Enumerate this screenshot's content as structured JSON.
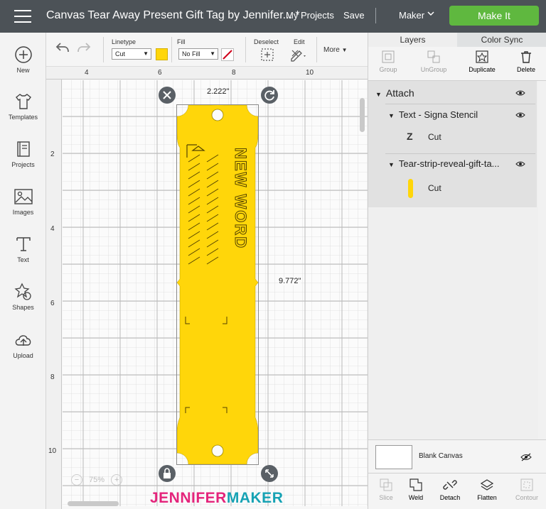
{
  "topbar": {
    "title": "Canvas Tear Away Present Gift Tag by Jennifer... *",
    "my_projects": "My Projects",
    "save": "Save",
    "machine": "Maker",
    "make_it": "Make It"
  },
  "leftbar": {
    "items": [
      {
        "label": "New",
        "icon": "plus-circle-icon"
      },
      {
        "label": "Templates",
        "icon": "tshirt-icon"
      },
      {
        "label": "Projects",
        "icon": "projects-icon"
      },
      {
        "label": "Images",
        "icon": "image-icon"
      },
      {
        "label": "Text",
        "icon": "text-icon"
      },
      {
        "label": "Shapes",
        "icon": "shapes-icon"
      },
      {
        "label": "Upload",
        "icon": "upload-icon"
      }
    ]
  },
  "toolbar": {
    "linetype_label": "Linetype",
    "linetype_value": "Cut",
    "fill_label": "Fill",
    "fill_value": "No Fill",
    "deselect_label": "Deselect",
    "edit_label": "Edit",
    "more_label": "More",
    "linetype_color": "#ffd60a"
  },
  "canvas": {
    "ruler_top": [
      "4",
      "6",
      "8",
      "10"
    ],
    "ruler_left": [
      "2",
      "4",
      "6",
      "8",
      "10"
    ],
    "width_label": "2.222\"",
    "height_label": "9.772\"",
    "tag_text": "NEW WORD",
    "tag_color": "#ffd60a",
    "zoom": "75%"
  },
  "right_panel": {
    "tabs": [
      "Layers",
      "Color Sync"
    ],
    "actions": [
      {
        "label": "Group",
        "icon": "group-icon",
        "enabled": false
      },
      {
        "label": "UnGroup",
        "icon": "ungroup-icon",
        "enabled": false
      },
      {
        "label": "Duplicate",
        "icon": "duplicate-icon",
        "enabled": true
      },
      {
        "label": "Delete",
        "icon": "trash-icon",
        "enabled": true
      }
    ],
    "layers": {
      "root": "Attach",
      "group1": "Text - Signa Stencil",
      "group1_item": "Cut",
      "group2": "Tear-strip-reveal-gift-ta...",
      "group2_item": "Cut"
    },
    "blank_canvas": "Blank Canvas",
    "bottom_actions": [
      {
        "label": "Slice",
        "icon": "slice-icon",
        "enabled": false
      },
      {
        "label": "Weld",
        "icon": "weld-icon",
        "enabled": true
      },
      {
        "label": "Detach",
        "icon": "detach-icon",
        "enabled": true
      },
      {
        "label": "Flatten",
        "icon": "flatten-icon",
        "enabled": true
      },
      {
        "label": "Contour",
        "icon": "contour-icon",
        "enabled": false
      }
    ]
  },
  "watermark": {
    "part1": "JENNIFER",
    "part2": "MAKER",
    "color1": "#e4247b",
    "color2": "#16a2b4"
  }
}
